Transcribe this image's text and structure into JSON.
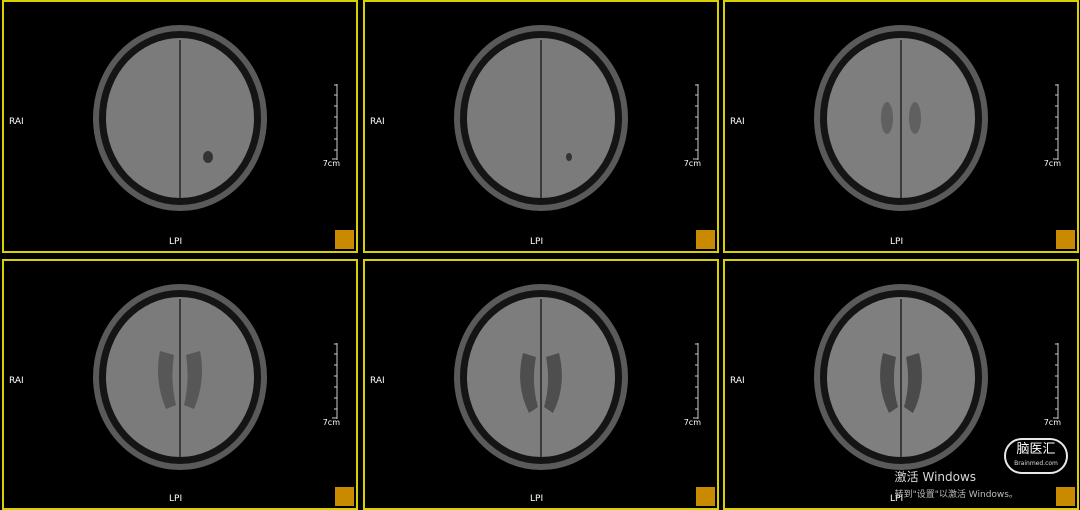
{
  "viewports": [
    {
      "orientation_left": "RAI",
      "orientation_bottom": "LPI",
      "scale_label": "7cm"
    },
    {
      "orientation_left": "RAI",
      "orientation_bottom": "LPI",
      "scale_label": "7cm"
    },
    {
      "orientation_left": "RAI",
      "orientation_bottom": "LPI",
      "scale_label": "7cm"
    },
    {
      "orientation_left": "RAI",
      "orientation_bottom": "LPI",
      "scale_label": "7cm"
    },
    {
      "orientation_left": "RAI",
      "orientation_bottom": "LPI",
      "scale_label": "7cm"
    },
    {
      "orientation_left": "RAI",
      "orientation_bottom": "LPI",
      "scale_label": "7cm"
    }
  ],
  "colors": {
    "viewport_border": "#d8d000",
    "corner_marker": "#c98a00",
    "background": "#000000"
  },
  "windows_watermark": {
    "line1": "激活 Windows",
    "line2": "转到\"设置\"以激活 Windows。"
  },
  "logo": {
    "text": "脑医汇",
    "subtext": "Brainmed.com"
  }
}
